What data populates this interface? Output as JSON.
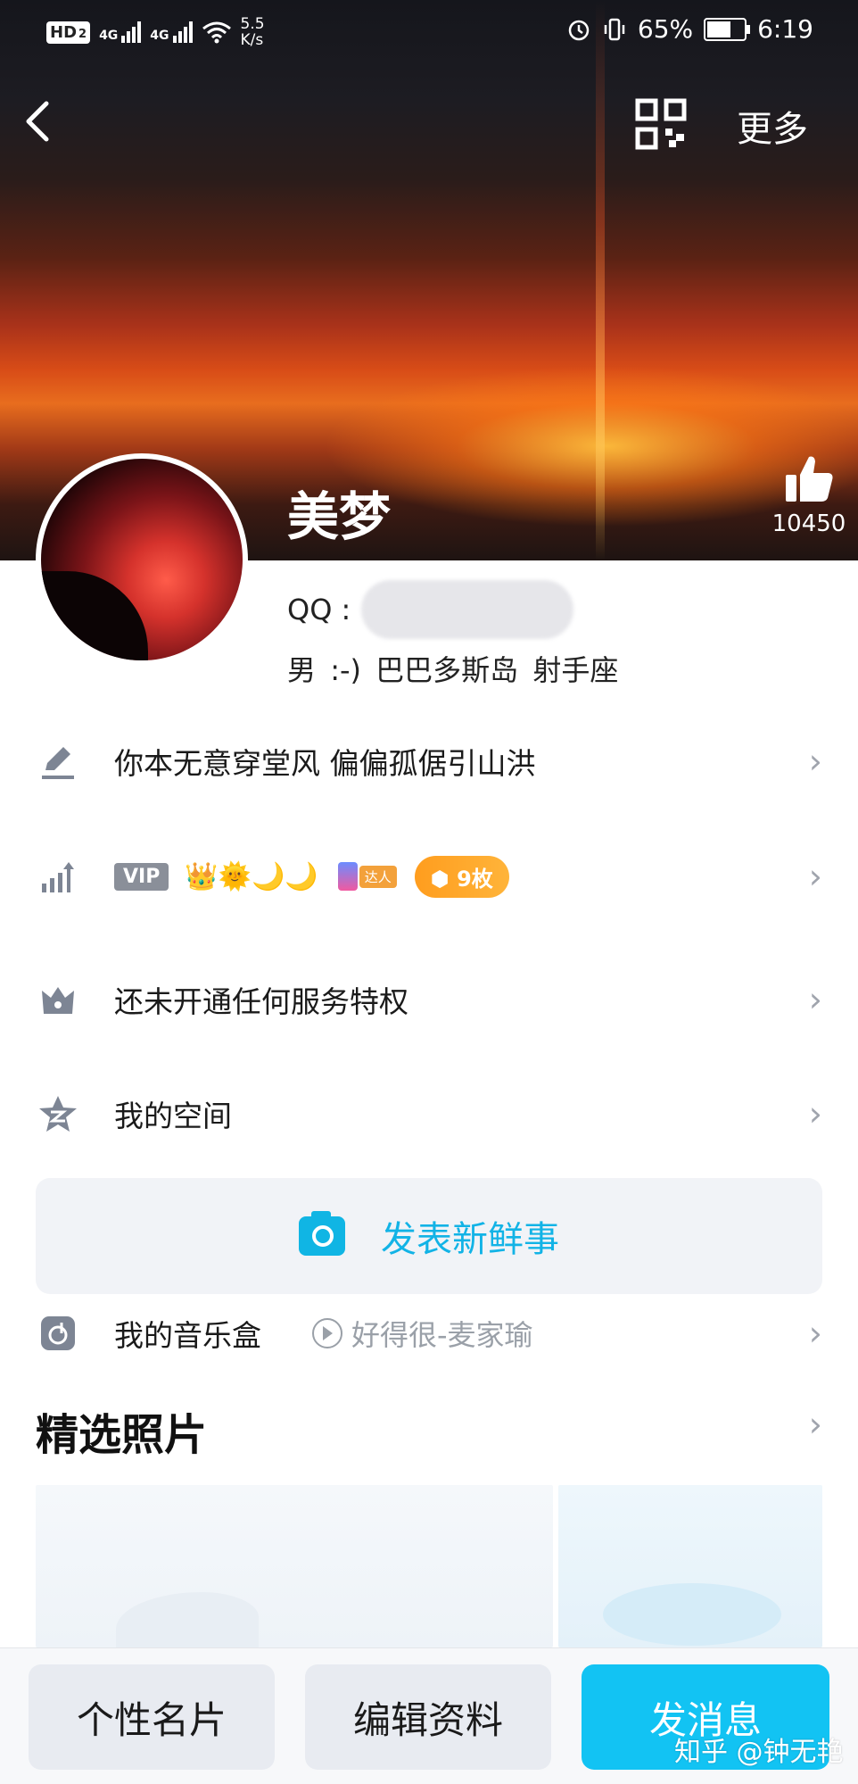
{
  "status_bar": {
    "hd_label": "HD",
    "hd_sub": "2",
    "network_1": "4G",
    "network_2": "4G",
    "speed_value": "5.5",
    "speed_unit": "K/s",
    "battery_percent": "65%",
    "battery_level": 0.65,
    "time": "6:19"
  },
  "nav": {
    "back_icon": "chevron-left-icon",
    "qr_icon": "qr-code-icon",
    "more_label": "更多"
  },
  "profile": {
    "nickname": "美梦",
    "like_count": "10450",
    "qq_label": "QQ :",
    "gender": "男",
    "emoticon": ":-)",
    "location": "巴巴多斯岛",
    "zodiac": "射手座"
  },
  "rows": {
    "signature": "你本无意穿堂风 偏偏孤倨引山洪",
    "vip_tag": "VIP",
    "badge_icons": "👑🌞🌙🌙",
    "talent_badge": "达人",
    "coins": "9枚",
    "privilege": "还未开通任何服务特权",
    "zone": "我的空间",
    "post_label": "发表新鲜事",
    "music_box": "我的音乐盒",
    "music_song": "好得很-麦家瑜"
  },
  "photos_section": {
    "title": "精选照片"
  },
  "bottom": {
    "card_button": "个性名片",
    "edit_button": "编辑资料",
    "message_button": "发消息"
  },
  "watermark": "知乎 @钟无艳",
  "colors": {
    "accent": "#12c3f3",
    "coin": "#ff9d1e",
    "icon_gray": "#7d8594"
  }
}
